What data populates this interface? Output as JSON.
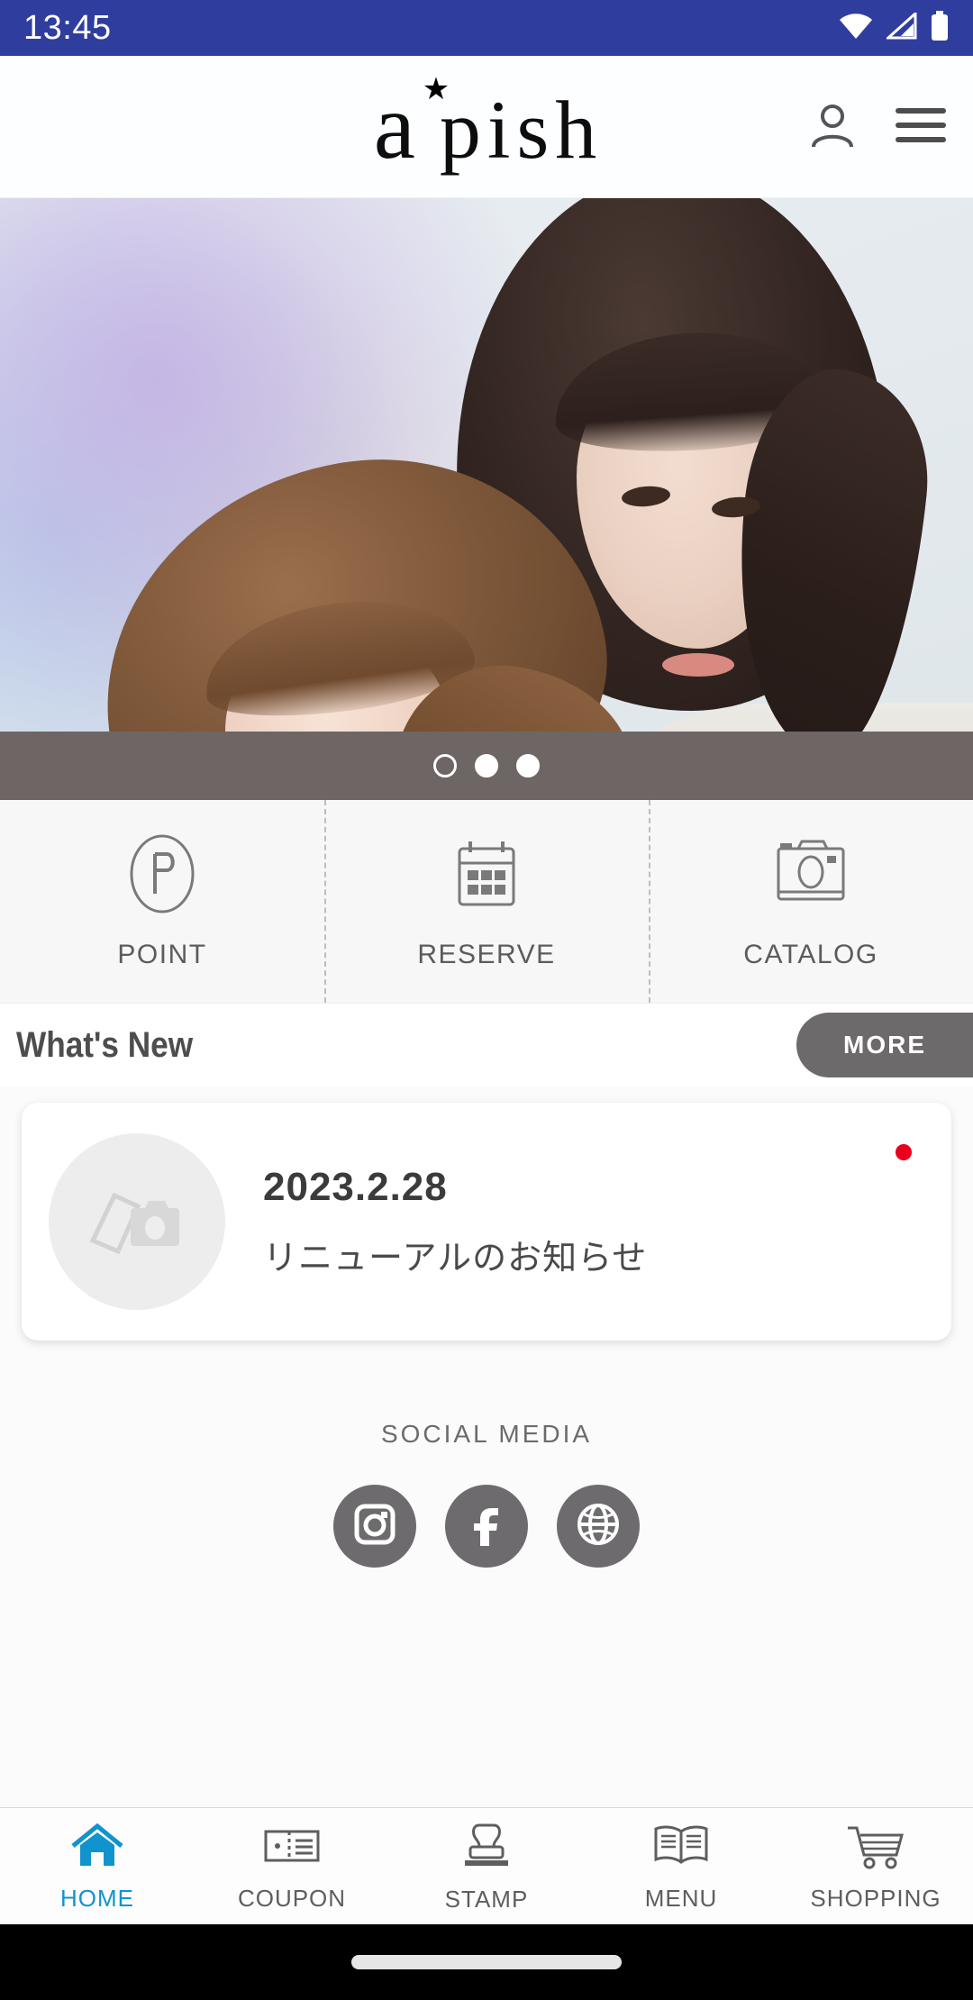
{
  "status_bar": {
    "time": "13:45",
    "icons": [
      "wifi-icon",
      "cellular-signal-icon",
      "battery-icon"
    ],
    "background_color": "#2f3e9e",
    "text_color": "#ffffff"
  },
  "header": {
    "logo_text_a": "a",
    "logo_star": "★",
    "logo_text_rest": "pish",
    "account_icon": "person-icon",
    "menu_icon": "hamburger-menu-icon"
  },
  "hero": {
    "alt": "two women with styled hair",
    "slide_count": 3,
    "active_slide": 1,
    "dots": [
      {
        "filled": false
      },
      {
        "filled": true
      },
      {
        "filled": true
      }
    ],
    "bar_color": "#6d6665"
  },
  "quick_actions": [
    {
      "label": "POINT",
      "icon": "point-p-circle-icon"
    },
    {
      "label": "RESERVE",
      "icon": "calendar-icon"
    },
    {
      "label": "CATALOG",
      "icon": "camera-icon"
    }
  ],
  "whats_new": {
    "title": "What's New",
    "more_label": "MORE",
    "more_color": "#6d6a6c",
    "items": [
      {
        "date": "2023.2.28",
        "headline": "リニューアルのお知らせ",
        "thumb_icon": "photo-placeholder-icon",
        "unread": true,
        "unread_color": "#e8001d"
      }
    ]
  },
  "social_media": {
    "title": "SOCIAL MEDIA",
    "links": [
      {
        "name": "instagram",
        "icon": "instagram-icon"
      },
      {
        "name": "facebook",
        "icon": "facebook-icon"
      },
      {
        "name": "website",
        "icon": "globe-icon"
      }
    ],
    "circle_color": "#6d6b6d"
  },
  "tabbar": {
    "active_color": "#1193cd",
    "inactive_color": "#5e5e5e",
    "items": [
      {
        "label": "HOME",
        "icon": "home-icon",
        "active": true
      },
      {
        "label": "COUPON",
        "icon": "ticket-icon",
        "active": false
      },
      {
        "label": "STAMP",
        "icon": "stamp-icon",
        "active": false
      },
      {
        "label": "MENU",
        "icon": "open-book-icon",
        "active": false
      },
      {
        "label": "SHOPPING",
        "icon": "cart-icon",
        "active": false
      }
    ]
  },
  "gesture_bar": {
    "handle": "home-gesture-pill"
  }
}
